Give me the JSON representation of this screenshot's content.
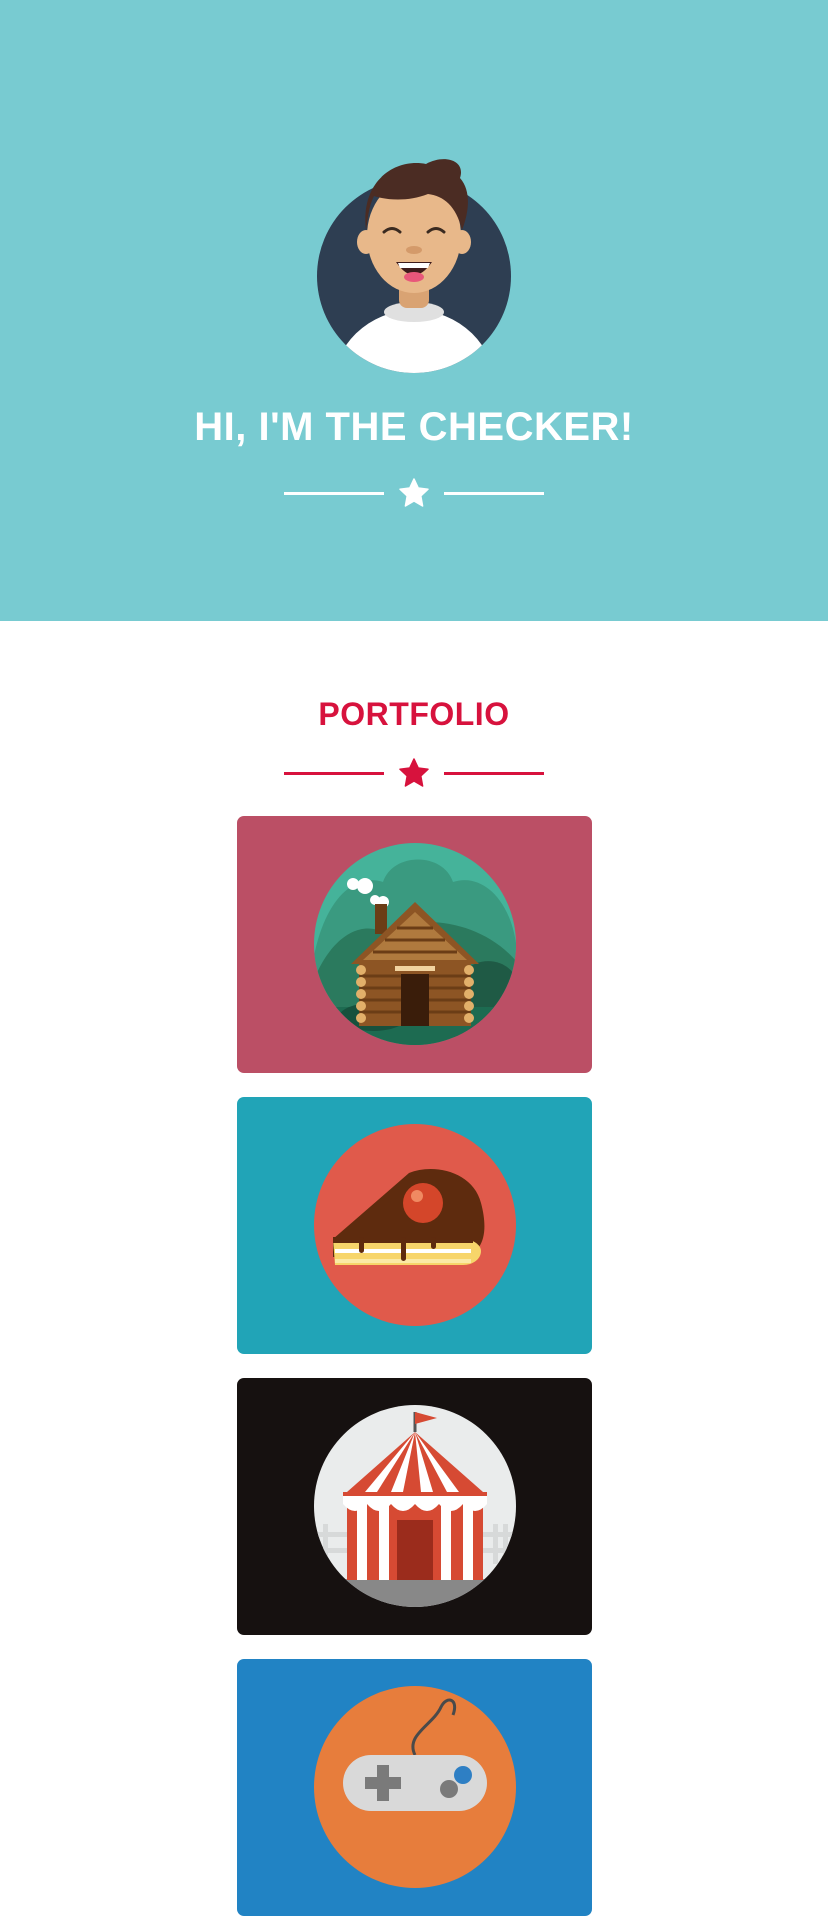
{
  "hero": {
    "title": "HI, I'M THE CHECKER!",
    "background": "#78cbd1",
    "avatar_icon": "smiling-person-avatar"
  },
  "portfolio": {
    "title": "PORTFOLIO",
    "accent": "#d7123d",
    "items": [
      {
        "icon": "log-cabin-icon",
        "background": "#bb4f65"
      },
      {
        "icon": "cake-slice-icon",
        "background": "#21a4b7"
      },
      {
        "icon": "circus-tent-icon",
        "background": "#161110"
      },
      {
        "icon": "game-controller-icon",
        "background": "#2183c4"
      }
    ]
  }
}
